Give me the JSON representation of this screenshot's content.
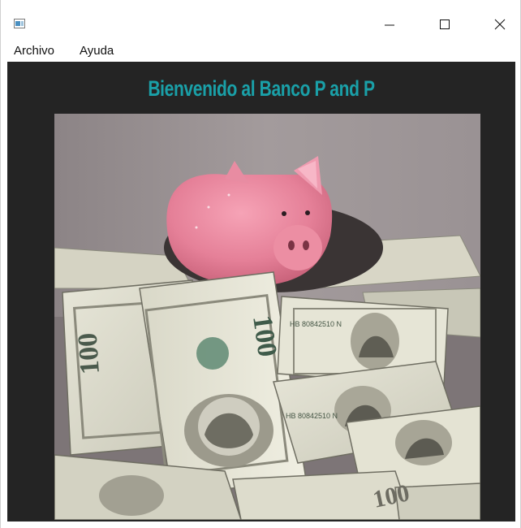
{
  "window": {
    "title": "",
    "app_icon": "app-window-icon",
    "controls": {
      "minimize": "minimize-icon",
      "maximize": "maximize-icon",
      "close": "close-icon"
    }
  },
  "menu": {
    "items": [
      {
        "label": "Archivo"
      },
      {
        "label": "Ayuda"
      }
    ]
  },
  "main": {
    "heading": "Bienvenido al Banco P and P",
    "heading_color": "#1aa0a8",
    "background_color": "#242424",
    "image": {
      "subject": "piggy-bank-on-dollar-bills"
    }
  }
}
